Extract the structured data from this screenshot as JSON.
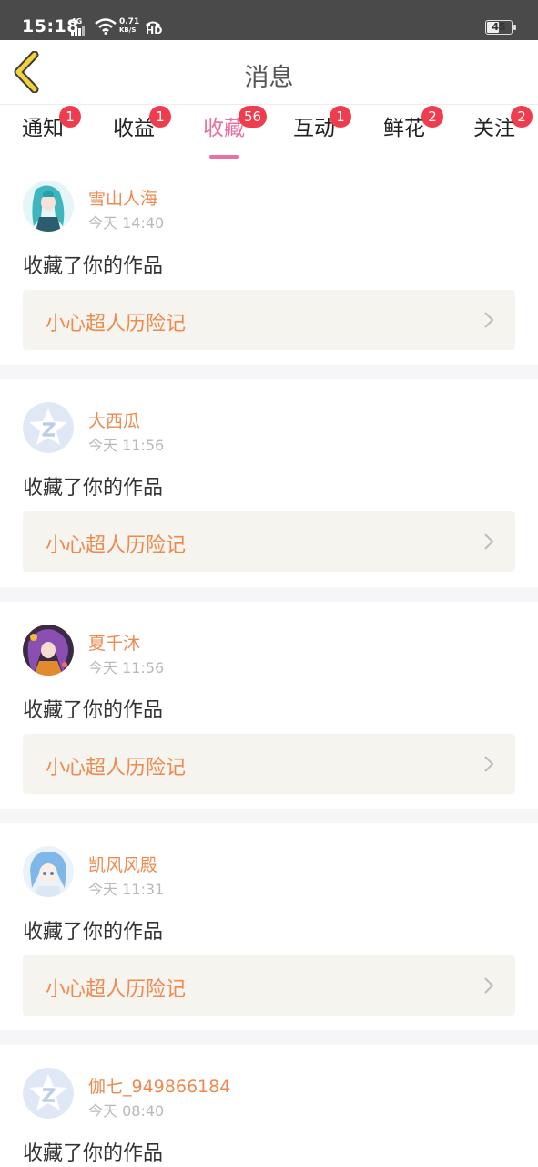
{
  "status_bar": {
    "time": "15:18",
    "network": "4G",
    "speed_value": "0.71",
    "speed_unit": "KB/S",
    "hd": "HD",
    "battery": "45",
    "battery_level": 0.45
  },
  "header": {
    "title": "消息",
    "back_icon": "chevron-left-icon",
    "back_color": "#f2d13a"
  },
  "tabs": [
    {
      "label": "通知",
      "badge": "1",
      "active": false
    },
    {
      "label": "收益",
      "badge": "1",
      "active": false
    },
    {
      "label": "收藏",
      "badge": "56",
      "active": true
    },
    {
      "label": "互动",
      "badge": "1",
      "active": false
    },
    {
      "label": "鲜花",
      "badge": "2",
      "active": false
    },
    {
      "label": "关注",
      "badge": "2",
      "active": false
    }
  ],
  "colors": {
    "accent": "#e8719f",
    "badge": "#ef3d4f",
    "username": "#ec8a50",
    "work_bg": "#f5f4ee"
  },
  "feed": [
    {
      "username": "雪山人海",
      "time": "今天 14:40",
      "action": "收藏了你的作品",
      "work": "小心超人历险记",
      "avatar": "anime-avatar-teal"
    },
    {
      "username": "大西瓜",
      "time": "今天 11:56",
      "action": "收藏了你的作品",
      "work": "小心超人历险记",
      "avatar": "default-avatar"
    },
    {
      "username": "夏千沐",
      "time": "今天 11:56",
      "action": "收藏了你的作品",
      "work": "小心超人历险记",
      "avatar": "anime-avatar-purple"
    },
    {
      "username": "凯风风殿",
      "time": "今天 11:31",
      "action": "收藏了你的作品",
      "work": "小心超人历险记",
      "avatar": "anime-avatar-blue"
    },
    {
      "username": "伽七_949866184",
      "time": "今天 08:40",
      "action": "收藏了你的作品",
      "work": "",
      "avatar": "default-avatar"
    }
  ]
}
